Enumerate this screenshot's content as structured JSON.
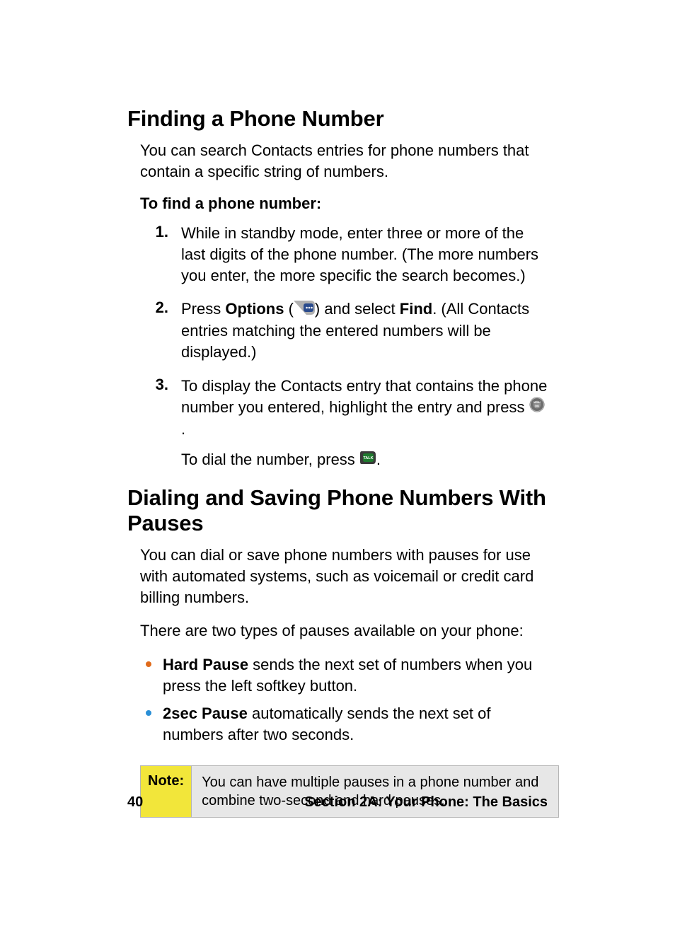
{
  "sections": {
    "finding": {
      "heading": "Finding a Phone Number",
      "intro": "You can search Contacts entries for phone numbers that contain a specific string of numbers.",
      "task_label": "To find a phone number:",
      "steps": [
        {
          "num": "1.",
          "text": "While in standby mode, enter three or more of the last digits of the phone number. (The more numbers you enter, the more specific the search becomes.)"
        },
        {
          "num": "2.",
          "pre": "Press ",
          "bold1": "Options",
          "mid": " (",
          "icon": "softkey",
          "post_icon": ") and select ",
          "bold2": "Find",
          "post2": ". (All Contacts entries matching the entered numbers will be displayed.)"
        },
        {
          "num": "3.",
          "line1_pre": "To display the Contacts entry that contains the phone number you entered, highlight the entry and press ",
          "line1_icon": "ok",
          "line1_post": ".",
          "line2_pre": "To dial the number, press ",
          "line2_icon": "talk",
          "line2_post": "."
        }
      ]
    },
    "pauses": {
      "heading": "Dialing and Saving Phone Numbers With Pauses",
      "intro": "You can dial or save phone numbers with pauses for use with automated systems, such as voicemail or credit card billing numbers.",
      "lead": "There are two types of pauses available on your phone:",
      "bullets": [
        {
          "color": "#e06a1a",
          "bold": "Hard Pause",
          "text": " sends the next set of numbers when you press the left softkey button."
        },
        {
          "color": "#2a8fd6",
          "bold": "2sec Pause",
          "text": " automatically sends the next set of numbers after two seconds."
        }
      ],
      "note_label": "Note:",
      "note_text": "You can have multiple pauses in a phone number and combine two-second and hard pauses."
    }
  },
  "footer": {
    "page": "40",
    "section": "Section 2A: Your Phone: The Basics"
  }
}
